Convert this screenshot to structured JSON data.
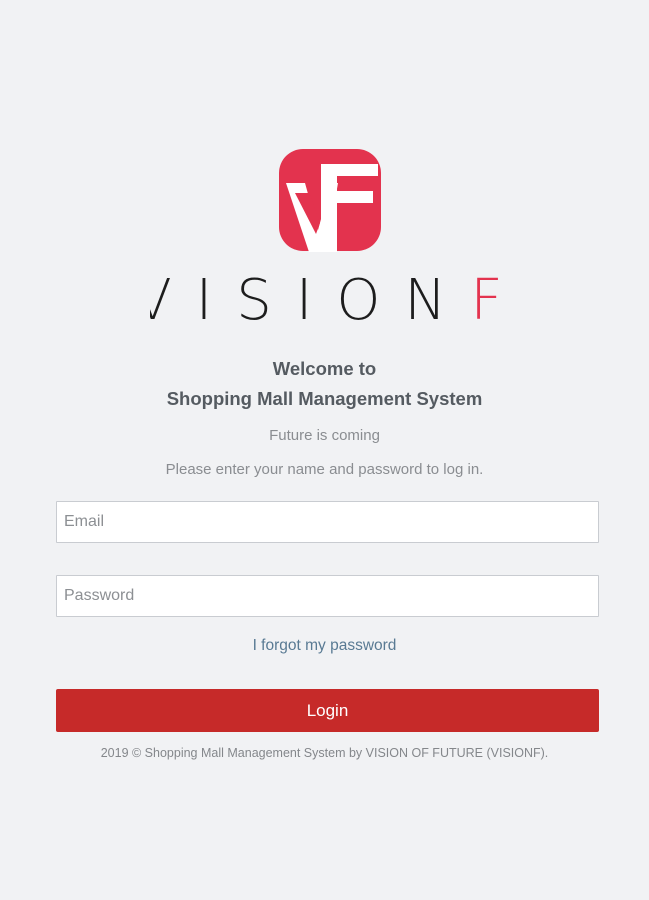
{
  "brand": {
    "logo_monogram": "VF",
    "wordmark": "VISIONF",
    "logo_color": "#e3334e",
    "wordmark_color": "#1d1d1d",
    "wordmark_accent_color": "#e3334e"
  },
  "welcome": {
    "line1": "Welcome to",
    "line2": "Shopping Mall Management System"
  },
  "subtitle": "Future is coming",
  "instructions": "Please enter your name and password to log in.",
  "form": {
    "email_placeholder": "Email",
    "email_value": "",
    "password_placeholder": "Password",
    "password_value": "",
    "forgot_link": "I forgot my password",
    "login_label": "Login",
    "login_color": "#c62a29"
  },
  "footer": "2019 © Shopping Mall Management System by VISION OF FUTURE (VISIONF)."
}
